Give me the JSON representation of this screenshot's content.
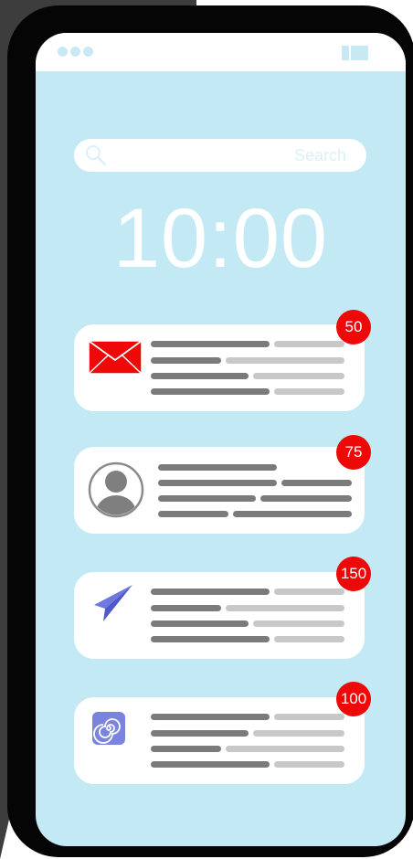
{
  "search": {
    "placeholder": "Search"
  },
  "lockscreen": {
    "time": "10:00"
  },
  "notifications": [
    {
      "app": "mail",
      "icon": "envelope-icon",
      "count": "50"
    },
    {
      "app": "contacts",
      "icon": "user-avatar-icon",
      "count": "75"
    },
    {
      "app": "messages",
      "icon": "paper-plane-icon",
      "count": "150"
    },
    {
      "app": "spiral-app",
      "icon": "spiral-icon",
      "count": "100"
    }
  ],
  "colors": {
    "screen_bg": "#c2e9f4",
    "badge": "#ee0808",
    "mail_red": "#ee0808",
    "plane_blue": "#6e78e0",
    "spiral_blue": "#7a84df"
  }
}
